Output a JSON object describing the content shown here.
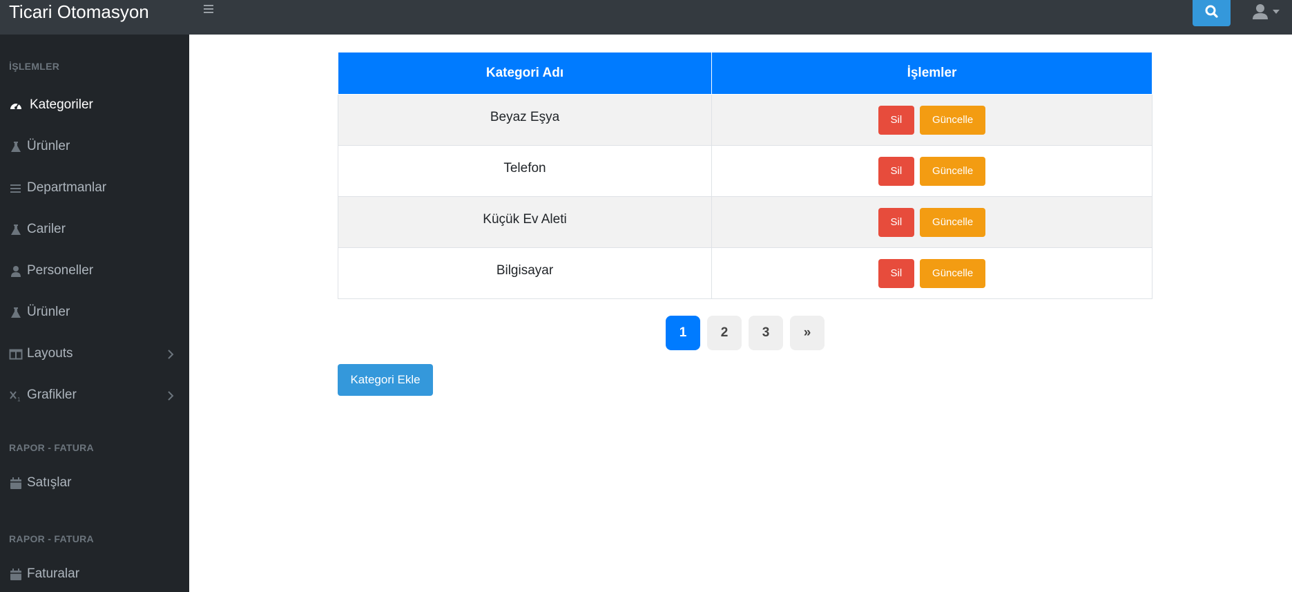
{
  "app": {
    "title": "Ticari Otomasyon"
  },
  "topbar": {
    "menu_icon": "hamburger-icon",
    "search_icon": "search-icon",
    "user_icon": "user-icon",
    "caret_icon": "caret-down-icon"
  },
  "sidebar": {
    "sections": [
      {
        "heading": "İŞLEMLER"
      },
      {
        "heading": "RAPOR - FATURA"
      },
      {
        "heading": "RAPOR - FATURA"
      }
    ],
    "items": [
      {
        "label": "Kategoriler",
        "icon": "dashboard-icon",
        "active": true
      },
      {
        "label": "Ürünler",
        "icon": "flask-icon"
      },
      {
        "label": "Departmanlar",
        "icon": "list-icon"
      },
      {
        "label": "Cariler",
        "icon": "flask-icon"
      },
      {
        "label": "Personeller",
        "icon": "user-icon"
      },
      {
        "label": "Ürünler",
        "icon": "flask-icon"
      },
      {
        "label": "Layouts",
        "icon": "columns-icon",
        "has_submenu": true
      },
      {
        "label": "Grafikler",
        "icon": "subscript-icon",
        "has_submenu": true
      },
      {
        "label": "Satışlar",
        "icon": "calendar-icon"
      },
      {
        "label": "Faturalar",
        "icon": "calendar-icon"
      }
    ]
  },
  "table": {
    "headers": [
      "Kategori Adı",
      "İşlemler"
    ],
    "rows": [
      {
        "name": "Beyaz Eşya",
        "delete": "Sil",
        "update": "Güncelle"
      },
      {
        "name": "Telefon",
        "delete": "Sil",
        "update": "Güncelle"
      },
      {
        "name": "Küçük Ev Aleti",
        "delete": "Sil",
        "update": "Güncelle"
      },
      {
        "name": "Bilgisayar",
        "delete": "Sil",
        "update": "Güncelle"
      }
    ]
  },
  "pagination": {
    "pages": [
      "1",
      "2",
      "3",
      "»"
    ],
    "active": "1"
  },
  "actions": {
    "add_label": "Kategori Ekle"
  },
  "colors": {
    "primary": "#007bff",
    "danger": "#e74c3c",
    "warning": "#f39c12",
    "info": "#3498db",
    "sidebar_bg": "#212529",
    "topbar_bg": "#343a40"
  }
}
